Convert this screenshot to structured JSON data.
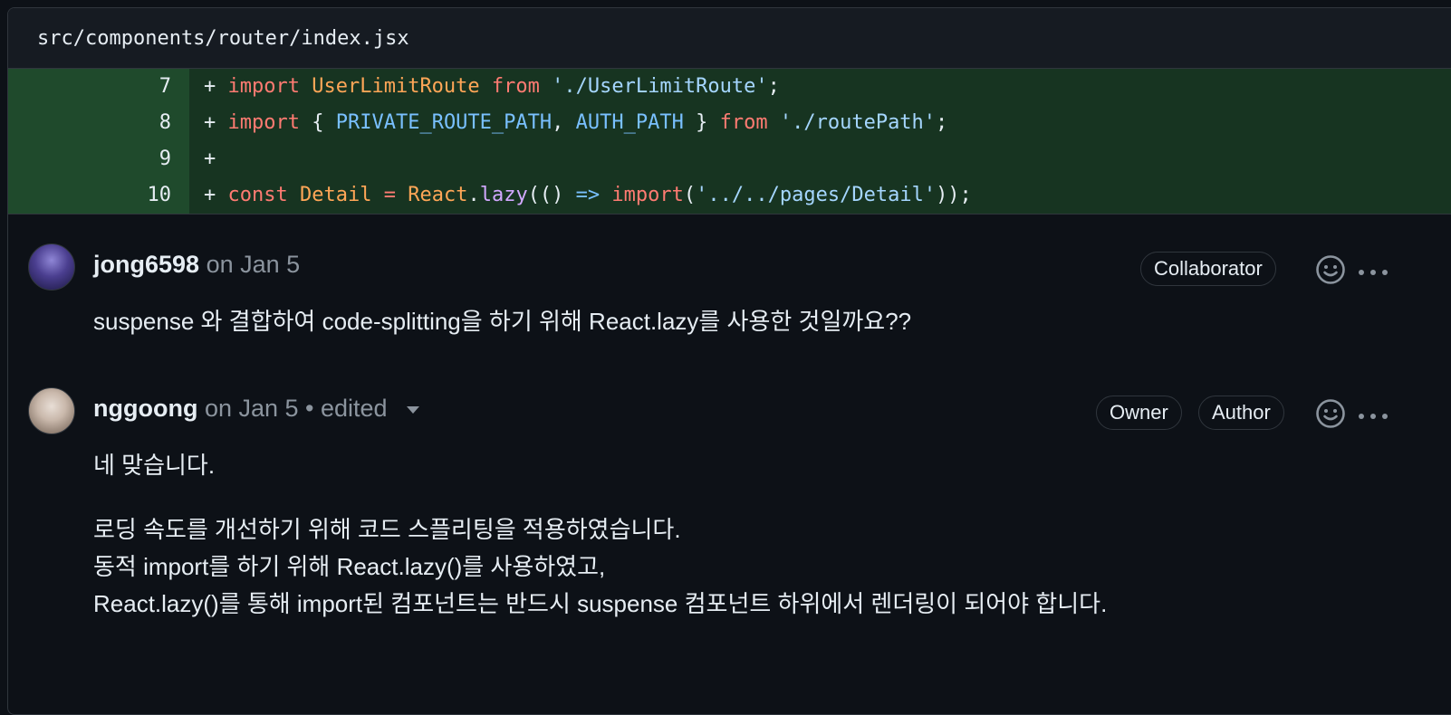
{
  "file": {
    "path": "src/components/router/index.jsx"
  },
  "diff_lines": [
    {
      "num": "7",
      "sign": "+"
    },
    {
      "num": "8",
      "sign": "+"
    },
    {
      "num": "9",
      "sign": "+"
    },
    {
      "num": "10",
      "sign": "+"
    }
  ],
  "code": {
    "l7": {
      "import": "import",
      "name": "UserLimitRoute",
      "from": "from",
      "path": "'./UserLimitRoute'",
      "semi": ";"
    },
    "l8": {
      "import": "import",
      "open": "{ ",
      "c1": "PRIVATE_ROUTE_PATH",
      "comma": ", ",
      "c2": "AUTH_PATH",
      "close": " } ",
      "from": "from",
      "path": "'./routePath'",
      "semi": ";"
    },
    "l10": {
      "const": "const",
      "name": "Detail",
      "eq": " = ",
      "obj": "React",
      "dot": ".",
      "fn": "lazy",
      "p1": "(() ",
      "arrow": "=>",
      "imp": "import",
      "p2": "(",
      "path": "'../../pages/Detail'",
      "end": "));"
    }
  },
  "comments": [
    {
      "author": "jong6598",
      "meta": "on Jan 5",
      "badges": [
        "Collaborator"
      ],
      "body": [
        "suspense 와 결합하여 code-splitting을 하기 위해 React.lazy를 사용한 것일까요??"
      ]
    },
    {
      "author": "nggoong",
      "meta": "on Jan 5 • edited",
      "badges": [
        "Owner",
        "Author"
      ],
      "body": [
        "네 맞습니다.",
        "로딩 속도를 개선하기 위해 코드 스플리팅을 적용하였습니다.",
        "동적 import를 하기 위해 React.lazy()를 사용하였고,",
        "React.lazy()를 통해 import된 컴포넌트는 반드시 suspense 컴포넌트 하위에서 렌더링이 되어야 합니다."
      ]
    }
  ],
  "icons": {
    "reaction": "smiley-icon",
    "menu": "kebab-horizontal-icon",
    "caret": "triangle-down-icon"
  },
  "colors": {
    "added_line_bg": "#173421",
    "added_num_bg": "#1f4a2c",
    "background": "#0d1117",
    "muted": "#8b949e"
  }
}
